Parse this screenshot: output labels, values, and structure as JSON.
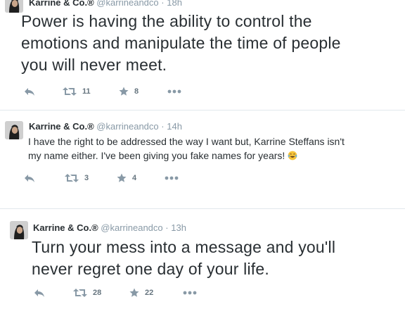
{
  "tweets": [
    {
      "name": "Karrine & Co.®",
      "handle": "@karrineandco",
      "separator": "·",
      "time": "18h",
      "text_lines": [
        "Power is having the ability to control the",
        "emotions and manipulate the time of people",
        "you will never meet."
      ],
      "retweets": "11",
      "favorites": "8",
      "icons": {
        "reply": "reply-icon",
        "retweet": "retweet-icon",
        "favorite": "star-icon",
        "more": "more-icon"
      }
    },
    {
      "name": "Karrine & Co.®",
      "handle": "@karrineandco",
      "separator": "·",
      "time": "14h",
      "text_lines": [
        "I have the right to be addressed the way I want but, Karrine Steffans isn't",
        "my name either. I've been giving you fake names for years!"
      ],
      "emoji": "face-with-tears-of-joy-emoji",
      "retweets": "3",
      "favorites": "4",
      "icons": {
        "reply": "reply-icon",
        "retweet": "retweet-icon",
        "favorite": "star-icon",
        "more": "more-icon"
      }
    },
    {
      "name": "Karrine & Co.®",
      "handle": "@karrineandco",
      "separator": "·",
      "time": "13h",
      "text_lines": [
        "Turn your mess into a message and you'll",
        "never regret one day of your life."
      ],
      "retweets": "28",
      "favorites": "22",
      "icons": {
        "reply": "reply-icon",
        "retweet": "retweet-icon",
        "favorite": "star-icon",
        "more": "more-icon"
      }
    }
  ],
  "colors": {
    "text": "#292f33",
    "meta": "#8899a6",
    "count": "#66757f",
    "divider": "#e1e8ed",
    "icon": "#8899a6"
  }
}
